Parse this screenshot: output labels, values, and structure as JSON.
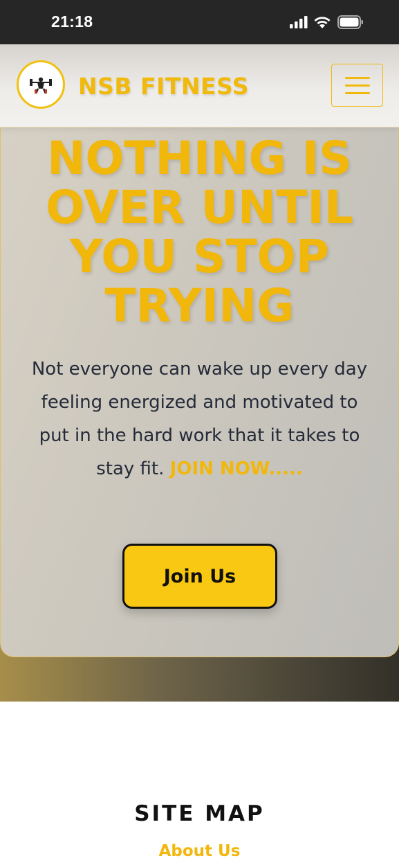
{
  "status_bar": {
    "time": "21:18",
    "icons": [
      "signal-icon",
      "wifi-icon",
      "battery-icon"
    ]
  },
  "header": {
    "logo_icon": "weightlifter-icon",
    "brand": "NSB FITNESS",
    "menu_icon": "hamburger-menu-icon"
  },
  "hero": {
    "headline_lines": [
      "NOTHING IS",
      "OVER UNTIL",
      "YOU STOP",
      "TRYING"
    ],
    "lead_text": "Not everyone can wake up every day feeling energized and motivated to put in the hard work that it takes to stay fit.",
    "lead_highlight": "JOIN NOW.....",
    "cta_label": "Join Us"
  },
  "footer": {
    "sitemap_title": "SITE MAP",
    "links": [
      "About Us"
    ]
  },
  "colors": {
    "accent": "#f2b70b",
    "button": "#f9c812",
    "text_dark": "#242a38",
    "status_bar": "#262626"
  }
}
